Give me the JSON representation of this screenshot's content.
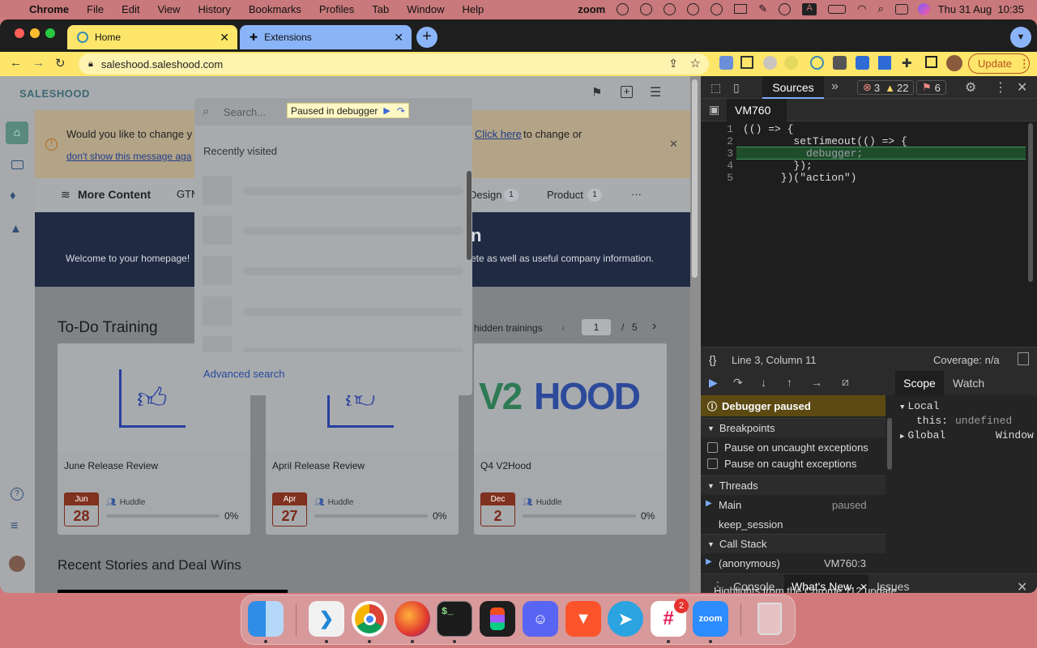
{
  "menubar": {
    "app": "Chrome",
    "items": [
      "File",
      "Edit",
      "View",
      "History",
      "Bookmarks",
      "Profiles",
      "Tab",
      "Window",
      "Help"
    ],
    "zoom": "zoom",
    "datetime": "Thu 31 Aug  10:35"
  },
  "tabs": [
    {
      "label": "Home",
      "active": true
    },
    {
      "label": "Extensions",
      "active": false
    }
  ],
  "address": {
    "url": "saleshood.saleshood.com",
    "update_label": "Update"
  },
  "page": {
    "logo": "SALESHOOD",
    "search_placeholder": "Search...",
    "debugger_badge": "Paused in debugger",
    "banner_text": "Would you like to change y",
    "banner_link": "Click here",
    "banner_rest": "to change or",
    "banner_dismiss": "don't show this message aga",
    "nav": {
      "more_content": "More Content",
      "gtm": "GTM",
      "design": "Design",
      "design_count": "1",
      "product": "Product",
      "product_count": "1",
      "more": "···"
    },
    "hero_partial": "n",
    "hero_welcome": "Welcome to your homepage!",
    "hero_rest": "ete as well as useful company information.",
    "todo_title": "To-Do Training",
    "hidden_trainings": "hidden trainings",
    "page_current": "1",
    "page_sep": "/",
    "page_total": "5",
    "recent_title": "Recent Stories and Deal Wins",
    "cards": [
      {
        "title": "June Release Review",
        "month": "Jun",
        "day": "28",
        "type": "Huddle",
        "progress": "0%"
      },
      {
        "title": "April Release Review",
        "month": "Apr",
        "day": "27",
        "type": "Huddle",
        "progress": "0%"
      },
      {
        "title": "Q4 V2Hood",
        "month": "Dec",
        "day": "2",
        "type": "Huddle",
        "progress": "0%",
        "logo_text_a": "V2",
        "logo_text_b": "HOOD"
      }
    ]
  },
  "search_dropdown": {
    "heading": "Recently visited",
    "advanced": "Advanced search"
  },
  "devtools": {
    "panel": "Sources",
    "errors": "3",
    "warnings": "22",
    "issues": "6",
    "file_tab": "VM760",
    "code_lines": [
      {
        "n": "1",
        "text": "(() => {"
      },
      {
        "n": "2",
        "text": "        setTimeout(() => {"
      },
      {
        "n": "3",
        "text": "          debugger;"
      },
      {
        "n": "4",
        "text": "        });"
      },
      {
        "n": "5",
        "text": "      })(\"action\")"
      }
    ],
    "status": "Line 3, Column 11",
    "coverage": "Coverage: n/a",
    "paused": "Debugger paused",
    "breakpoints": "Breakpoints",
    "pause_uncaught": "Pause on uncaught exceptions",
    "pause_caught": "Pause on caught exceptions",
    "threads": "Threads",
    "thread_main": "Main",
    "thread_main_state": "paused",
    "thread_keep": "keep_session",
    "call_stack": "Call Stack",
    "frame": "(anonymous)",
    "frame_loc": "VM760:3",
    "scope_tab": "Scope",
    "watch_tab": "Watch",
    "local": "Local",
    "this_key": "this:",
    "this_val": "undefined",
    "global": "Global",
    "global_val": "Window",
    "drawer_tabs": [
      "Console",
      "What's New",
      "Issues"
    ],
    "drawer_text": "Highlights from the Chrome 112 update"
  },
  "dock": {
    "apps": [
      "Finder",
      "VS Code",
      "Chrome",
      "Firefox",
      "Terminal",
      "Figma",
      "Discord",
      "Brave",
      "Telegram",
      "Slack",
      "Zoom",
      "Trash"
    ],
    "slack_badge": "2",
    "zoom_label": "zoom"
  }
}
